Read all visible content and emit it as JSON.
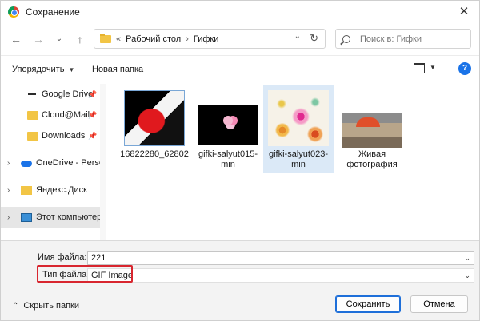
{
  "window": {
    "title": "Сохранение",
    "close_icon": "close-icon"
  },
  "nav": {
    "back": "←",
    "forward": "→",
    "recent": "⌄",
    "up": "↑"
  },
  "address": {
    "prefix": "«",
    "crumbs": [
      "Рабочий стол",
      "Гифки"
    ],
    "separator": "›"
  },
  "search": {
    "placeholder": "Поиск в: Гифки"
  },
  "toolbar": {
    "organize_label": "Упорядочить",
    "new_folder_label": "Новая папка",
    "help_label": "?"
  },
  "sidebar": {
    "items": [
      {
        "label": "Google Drive",
        "icon": "drive-icon",
        "pinned": true
      },
      {
        "label": "Cloud@Mail",
        "icon": "folder-icon",
        "pinned": true
      },
      {
        "label": "Downloads",
        "icon": "folder-icon",
        "pinned": true
      },
      {
        "label": "OneDrive - Personal",
        "icon": "onedrive-icon",
        "expandable": true
      },
      {
        "label": "Яндекс.Диск",
        "icon": "yandex-disk-icon",
        "expandable": true
      },
      {
        "label": "Этот компьютер",
        "icon": "computer-icon",
        "expandable": true,
        "selected": true
      }
    ]
  },
  "files": [
    {
      "name": "16822280_62802",
      "selected": false
    },
    {
      "name": "gifki-salyut015-min",
      "selected": false
    },
    {
      "name": "gifki-salyut023-min",
      "selected": true
    },
    {
      "name": "Живая фотография",
      "selected": false
    }
  ],
  "form": {
    "filename_label": "Имя файла:",
    "filename_value": "221",
    "filetype_label": "Тип файла:",
    "filetype_value": "GIF Image"
  },
  "footer": {
    "hide_folders_label": "Скрыть папки",
    "save_label": "Сохранить",
    "cancel_label": "Отмена"
  },
  "colors": {
    "accent": "#1e6fd9",
    "highlight_border": "#d8262f",
    "selection": "#dbe9f7"
  }
}
